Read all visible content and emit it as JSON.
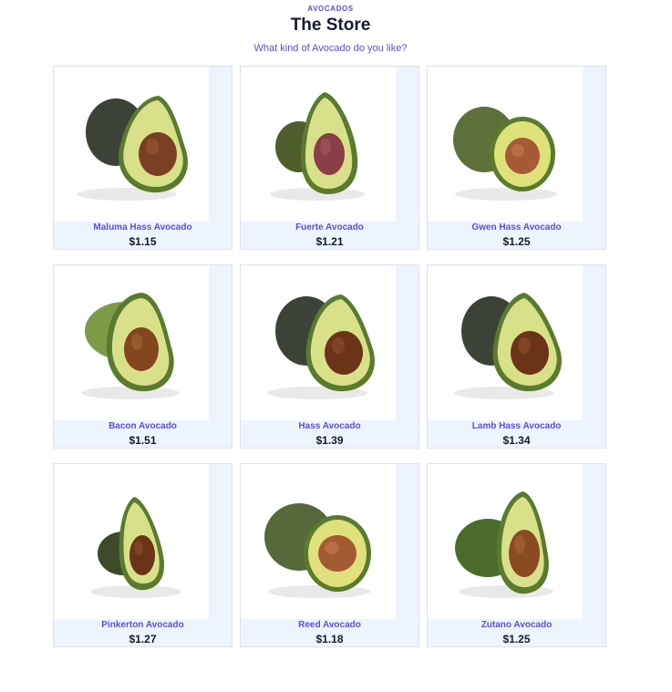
{
  "header": {
    "eyebrow": "AVOCADOS",
    "title": "The Store",
    "subtitle": "What kind of Avocado do you like?"
  },
  "products": [
    {
      "name": "Maluma Hass Avocado",
      "price": "$1.15",
      "image": "avocado-halves-hass-image"
    },
    {
      "name": "Fuerte Avocado",
      "price": "$1.21",
      "image": "avocado-halves-fuerte-image"
    },
    {
      "name": "Gwen Hass Avocado",
      "price": "$1.25",
      "image": "avocado-halves-gwen-image"
    },
    {
      "name": "Bacon Avocado",
      "price": "$1.51",
      "image": "avocado-halves-bacon-image"
    },
    {
      "name": "Hass Avocado",
      "price": "$1.39",
      "image": "avocado-halves-hass-image"
    },
    {
      "name": "Lamb Hass Avocado",
      "price": "$1.34",
      "image": "avocado-halves-lamb-image"
    },
    {
      "name": "Pinkerton Avocado",
      "price": "$1.27",
      "image": "avocado-halves-pinkerton-image"
    },
    {
      "name": "Reed Avocado",
      "price": "$1.18",
      "image": "avocado-halves-reed-image"
    },
    {
      "name": "Zutano Avocado",
      "price": "$1.25",
      "image": "avocado-halves-zutano-image"
    }
  ],
  "colors": {
    "accent": "#5b4fd6",
    "text": "#141b2d",
    "card_background": "#eef4fe",
    "card_border": "#dde2ea",
    "skin_dark": "#3c4238",
    "skin_green": "#5f7a35",
    "flesh": "#d9e08a",
    "flesh_rim": "#8fac3c",
    "pit": "#7a3e22"
  }
}
